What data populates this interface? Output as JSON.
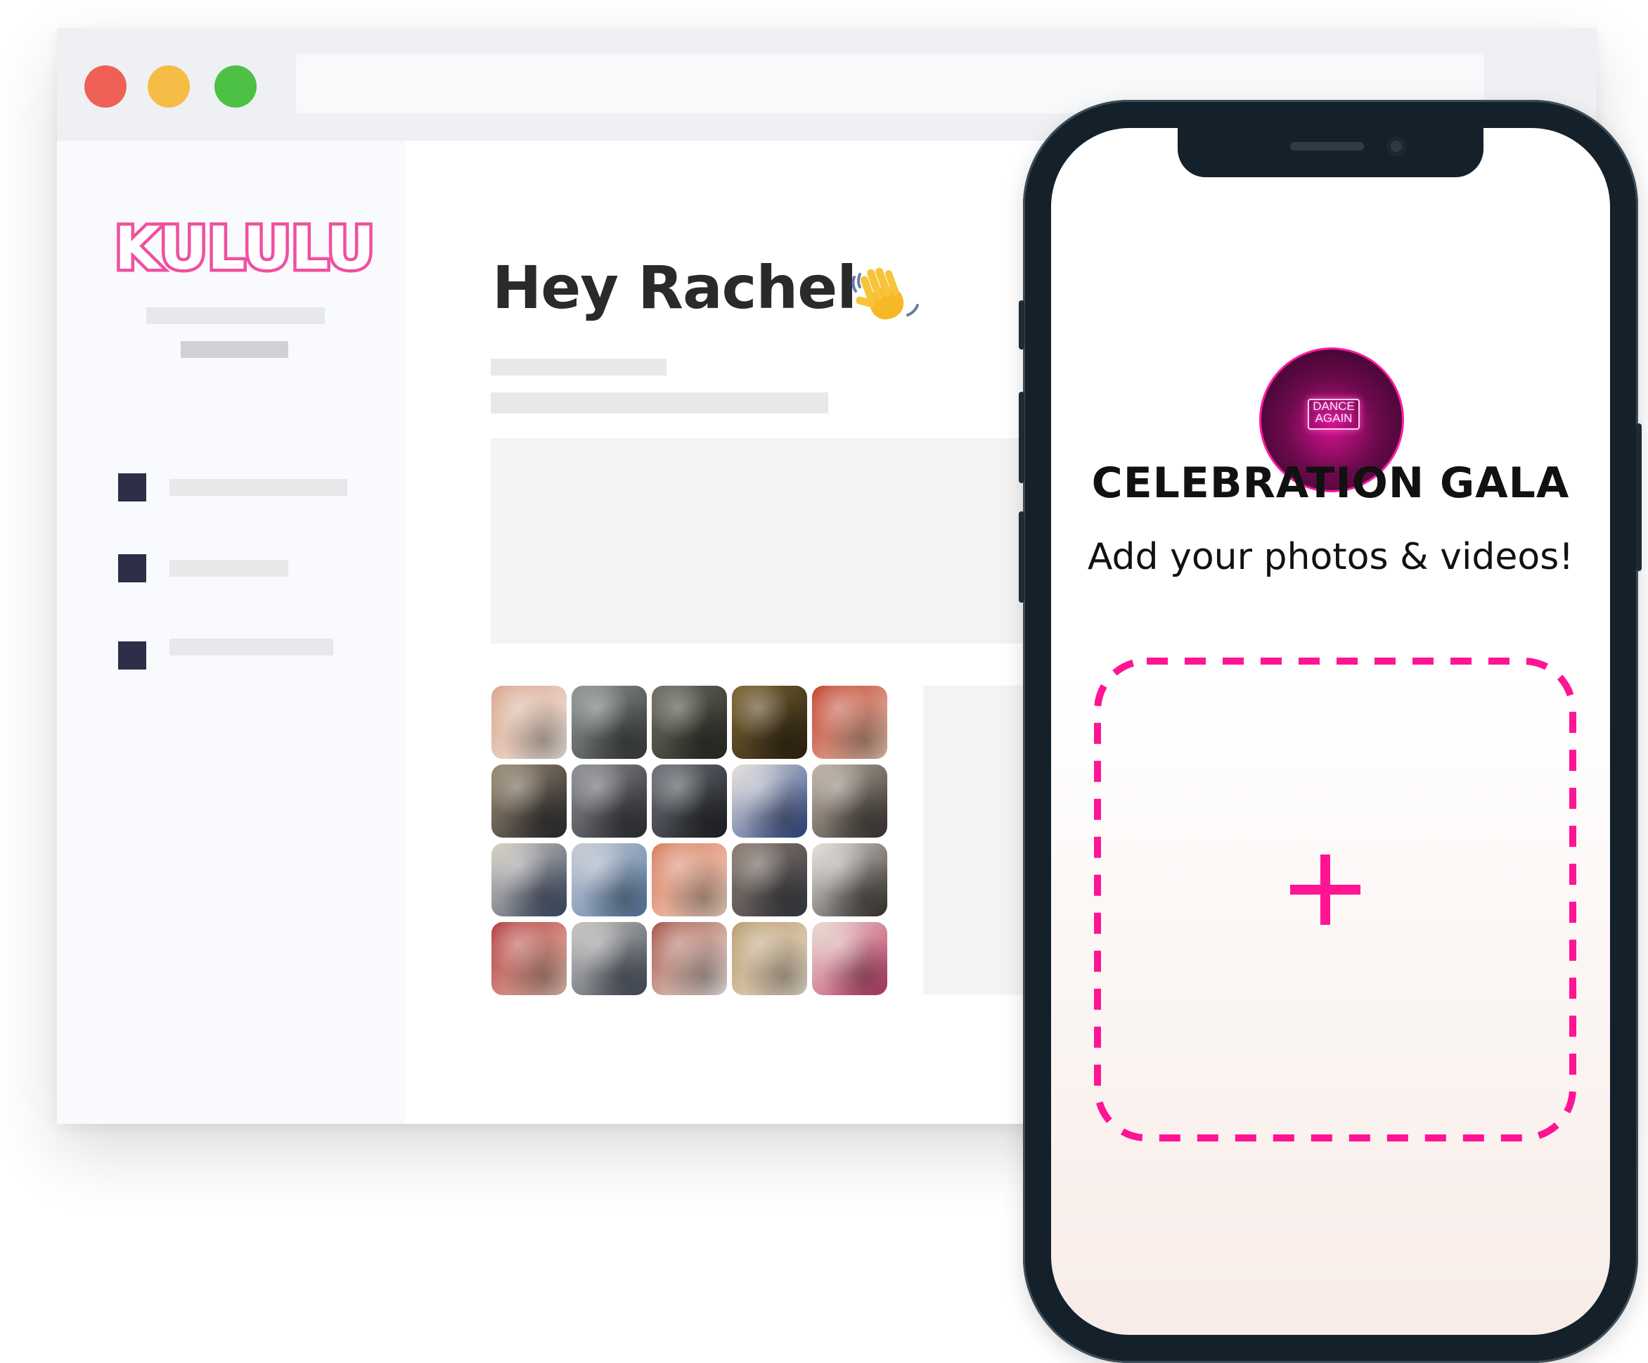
{
  "browser": {
    "traffic_lights": [
      "close-button",
      "minimize-button",
      "maximize-button"
    ],
    "colors": {
      "close": "#ee6056",
      "minimize": "#f5bd45",
      "maximize": "#4dc144"
    }
  },
  "sidebar": {
    "logo_text": "KULULU",
    "logo_color": "#f0509f",
    "nav_items": 3
  },
  "main": {
    "greeting": "Hey Rachel",
    "greeting_emoji_icon": "waving-hand-icon",
    "photo_grid": {
      "rows": 4,
      "columns": 5,
      "tiles": [
        [
          "#d7a38a",
          "#f3ece4"
        ],
        [
          "#8e9591",
          "#3a3d3d"
        ],
        [
          "#6c6c60",
          "#2b2b25"
        ],
        [
          "#7a6230",
          "#2e2413"
        ],
        [
          "#c1402d",
          "#e6c6b1"
        ],
        [
          "#9b8a70",
          "#2b2c30"
        ],
        [
          "#8c8d93",
          "#2f3135"
        ],
        [
          "#6d7178",
          "#202226"
        ],
        [
          "#e8e2dc",
          "#2e4a8a"
        ],
        [
          "#c0b3a4",
          "#3b3634"
        ],
        [
          "#d8d0c2",
          "#3b4b6b"
        ],
        [
          "#c7cbd2",
          "#5a7ea8"
        ],
        [
          "#d77b5c",
          "#f1d7c6"
        ],
        [
          "#8a7a6e",
          "#3a3d46"
        ],
        [
          "#e8e3de",
          "#3a3530"
        ],
        [
          "#b23c3f",
          "#e7c3b1"
        ],
        [
          "#c9c5c0",
          "#46505f"
        ],
        [
          "#a35343",
          "#f1ebe7"
        ],
        [
          "#b89a6e",
          "#e9dfcd"
        ],
        [
          "#e8dcd0",
          "#c23d6c"
        ]
      ]
    }
  },
  "phone": {
    "event_avatar_text": "DANCE AGAIN",
    "event_title": "CELEBRATION GALA",
    "event_subtitle": "Add your photos & videos!",
    "upload_icon": "plus-icon",
    "accent": "#ff1493"
  }
}
